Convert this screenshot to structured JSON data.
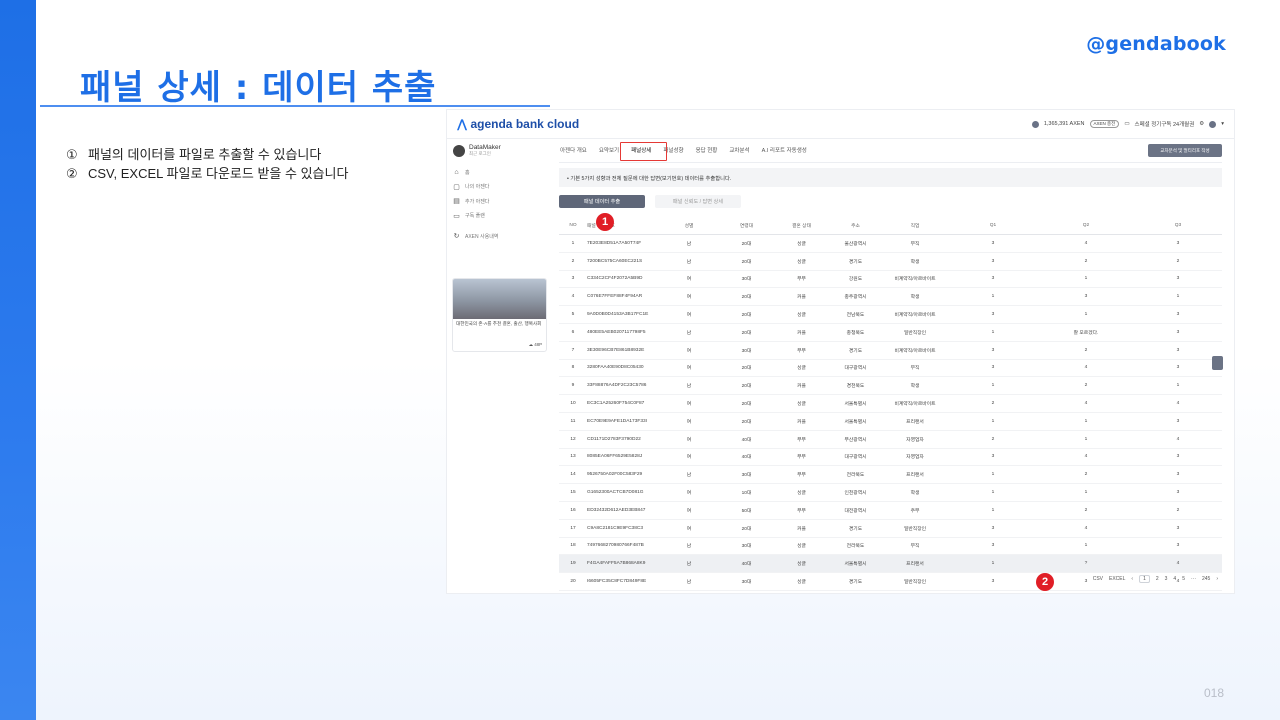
{
  "brand": "@gendabook",
  "slide_title": "패널 상세 : 데이터 추출",
  "descriptions": [
    {
      "num": "①",
      "text": "패널의 데이터를 파일로 추출할 수 있습니다"
    },
    {
      "num": "②",
      "text": "CSV, EXCEL 파일로 다운로드 받을 수 있습니다"
    }
  ],
  "page_number": "018",
  "app": {
    "logo": "agenda bank cloud",
    "top_right": {
      "points": "1,365,391 AXEN",
      "pill": "AXEN 충전",
      "subscription": "스페셜 정기구독 24개월권"
    },
    "user": {
      "name": "DataMaker",
      "sub": "최근 로그인"
    },
    "nav": [
      {
        "icon": "⌂",
        "label": "홈"
      },
      {
        "icon": "▢",
        "label": "나의 아젠다"
      },
      {
        "icon": "▤",
        "label": "추가 아젠다"
      },
      {
        "icon": "▭",
        "label": "구독 플랜"
      },
      {
        "icon": "↻",
        "label": "AXEN 사용내역"
      }
    ],
    "card": {
      "caption": "대한민국의 존·A를 추천 결혼, 출산, 행복사회",
      "footer": "48P"
    },
    "tabs": [
      "아젠다 개요",
      "요약보기",
      "패널상세",
      "패널성향",
      "응답 현황",
      "교차분석",
      "A.I 리포트 자동생성"
    ],
    "action_button": "교차분석 및 멀티리포 작성",
    "notice": "• 기본 5가지 성향과 전체 질문에 대한 답변(보기번호) 데이터를 추출합니다.",
    "btn_extract": "패널 데이터 추출",
    "btn_trend": "패널 신뢰도 / 답변 상세",
    "columns": [
      "NO",
      "패널 고유번호",
      "성별",
      "연령대",
      "결혼 상태",
      "주소",
      "직업",
      "Q1",
      "Q2",
      "Q3"
    ],
    "rows": [
      [
        "1",
        "7E203E8D51A7A50T74F",
        "남",
        "20대",
        "싱글",
        "울산광역시",
        "무직",
        "3",
        "4",
        "3"
      ],
      [
        "2",
        "7200BC575CA60EC221S",
        "남",
        "20대",
        "싱글",
        "경기도",
        "학생",
        "3",
        "2",
        "2"
      ],
      [
        "3",
        "C334C2CF4F2072A5B9D",
        "여",
        "30대",
        "부부",
        "강원도",
        "비계약직/아르바이트",
        "3",
        "1",
        "3"
      ],
      [
        "4",
        "C076E7FFEF88F4F94AR",
        "여",
        "20대",
        "커플",
        "충주광역시",
        "학생",
        "1",
        "3",
        "1"
      ],
      [
        "5",
        "9A0D0B0D4153A3B17FC1E",
        "여",
        "20대",
        "싱글",
        "전남북도",
        "비계약직/아르바이트",
        "3",
        "1",
        "3"
      ],
      [
        "6",
        "480EE5AEB0207117798F5",
        "남",
        "20대",
        "커플",
        "충청북도",
        "일반직장인",
        "1",
        "잘 모르겠다.",
        "3"
      ],
      [
        "7",
        "3E30E96CB7E861B8932E",
        "여",
        "30대",
        "부부",
        "경기도",
        "비계약직/아르바이트",
        "3",
        "2",
        "3"
      ],
      [
        "8",
        "3280FAA40E90D8C05430",
        "여",
        "20대",
        "싱글",
        "대구광역시",
        "무직",
        "3",
        "4",
        "3"
      ],
      [
        "9",
        "33F88876A4DF2C23C5786",
        "남",
        "20대",
        "커플",
        "경천북도",
        "학생",
        "1",
        "2",
        "1"
      ],
      [
        "10",
        "EC3C1A25260F754C0F87",
        "여",
        "20대",
        "싱글",
        "서울특별시",
        "비계약직/아르바이트",
        "2",
        "4",
        "4"
      ],
      [
        "11",
        "EC70E9E9AFE1DA173F33I",
        "여",
        "20대",
        "커플",
        "서울특별시",
        "프리랜서",
        "1",
        "1",
        "3"
      ],
      [
        "12",
        "CD1171D2783F3790D22",
        "여",
        "40대",
        "부부",
        "부산광역시",
        "자영업자",
        "2",
        "1",
        "4"
      ],
      [
        "13",
        "8085EA06FF6529E5828J",
        "여",
        "40대",
        "부부",
        "대구광역시",
        "자영업자",
        "3",
        "4",
        "3"
      ],
      [
        "14",
        "9526750A02F00C583F29",
        "남",
        "30대",
        "부부",
        "전라북도",
        "프리랜서",
        "1",
        "2",
        "3"
      ],
      [
        "15",
        "G1652300ACTCB7D081G",
        "여",
        "10대",
        "싱글",
        "인천광역시",
        "학생",
        "1",
        "1",
        "3"
      ],
      [
        "16",
        "ED32432D612AED3EB847",
        "여",
        "50대",
        "부부",
        "대전광역시",
        "주부",
        "1",
        "2",
        "2"
      ],
      [
        "17",
        "C9A8C2181C9E9FC38C3",
        "여",
        "20대",
        "커플",
        "경기도",
        "일반직장인",
        "3",
        "4",
        "3"
      ],
      [
        "18",
        "7497668270980766F487B",
        "남",
        "30대",
        "싱글",
        "전라북도",
        "무직",
        "3",
        "1",
        "3"
      ],
      [
        "19",
        "F4GA4FAFF5A7B868A8K9",
        "남",
        "40대",
        "싱글",
        "서울특별시",
        "프리랜서",
        "1",
        "?",
        "4"
      ],
      [
        "20",
        "I6605FC35C8FC7D849F8E",
        "남",
        "30대",
        "싱글",
        "경기도",
        "일반직장인",
        "3",
        "3",
        "4"
      ]
    ],
    "pager": {
      "csv": "CSV",
      "excel": "EXCEL",
      "prev": "‹",
      "pages": [
        "1",
        "2",
        "3",
        "4",
        "5"
      ],
      "ellipsis": "···",
      "last": "245",
      "next": "›"
    }
  },
  "badges": [
    "1",
    "2"
  ]
}
